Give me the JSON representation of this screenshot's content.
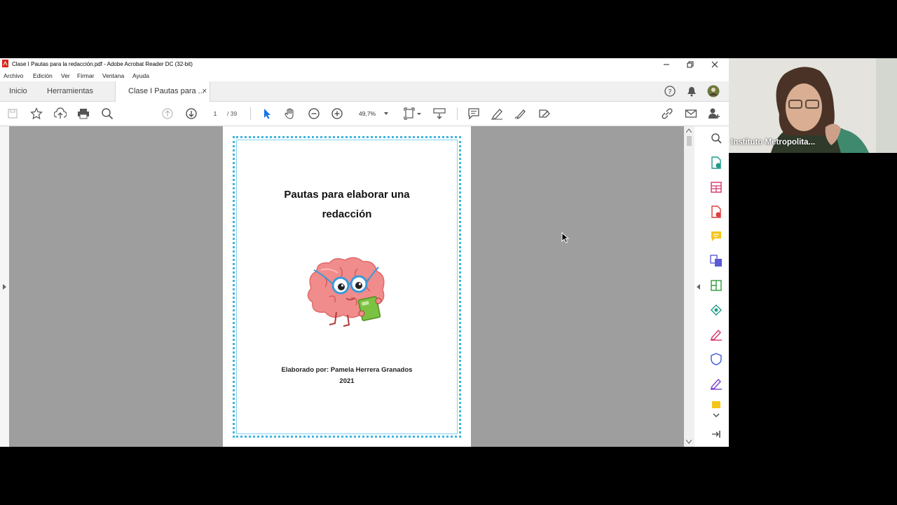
{
  "window": {
    "title": "Clase I Pautas para la redacción.pdf - Adobe Acrobat Reader DC (32-bit)",
    "controls": [
      "minimize",
      "restore",
      "close"
    ]
  },
  "menu": [
    "Archivo",
    "Edición",
    "Ver",
    "Firmar",
    "Ventana",
    "Ayuda"
  ],
  "tabs": {
    "home": "Inicio",
    "tools": "Herramientas",
    "document": "Clase I Pautas para ...",
    "close": "×"
  },
  "toolbar": {
    "page_current": "1",
    "page_total": "/  39",
    "zoom": "49,7%"
  },
  "document": {
    "title_line1": "Pautas para elaborar una",
    "title_line2": "redacción",
    "author": "Elaborado por: Pamela Herrera Granados",
    "year": "2021"
  },
  "webcam": {
    "participant_name": "Instituto Metropolita..."
  },
  "colors": {
    "page_border": "#3fb6df",
    "doc_background": "#9e9e9e",
    "toolbar_blue": "#1473e6"
  }
}
